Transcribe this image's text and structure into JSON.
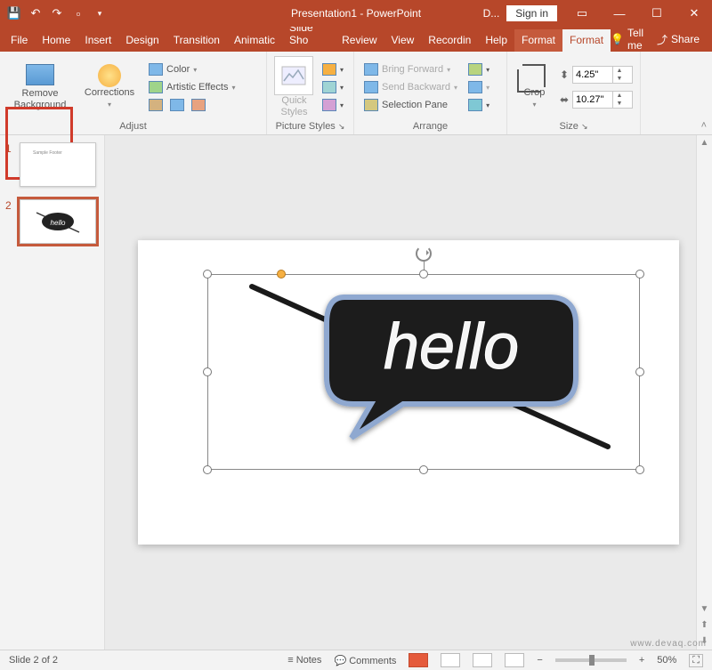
{
  "titlebar": {
    "doc_title": "Presentation1 - PowerPoint",
    "context_label": "D...",
    "signin": "Sign in"
  },
  "tabs": {
    "file": "File",
    "home": "Home",
    "insert": "Insert",
    "design": "Design",
    "transitions": "Transition",
    "animations": "Animatic",
    "slideshow": "Slide Sho",
    "review": "Review",
    "view": "View",
    "recording": "Recordin",
    "help": "Help",
    "format1": "Format",
    "format2": "Format",
    "tellme": "Tell me",
    "share": "Share"
  },
  "ribbon": {
    "remove_bg": "Remove\nBackground",
    "corrections": "Corrections",
    "color": "Color",
    "artistic": "Artistic Effects",
    "adjust_label": "Adjust",
    "quick_styles": "Quick\nStyles",
    "picstyles_label": "Picture Styles",
    "bring_forward": "Bring Forward",
    "send_backward": "Send Backward",
    "selection_pane": "Selection Pane",
    "arrange_label": "Arrange",
    "crop": "Crop",
    "height": "4.25\"",
    "width": "10.27\"",
    "size_label": "Size"
  },
  "thumbs": {
    "n1": "1",
    "n2": "2",
    "t1_text": "Sample Footer"
  },
  "status": {
    "slide_of": "Slide 2 of 2",
    "notes": "Notes",
    "comments": "Comments",
    "zoom": "50%"
  },
  "watermark": "www.devaq.com"
}
